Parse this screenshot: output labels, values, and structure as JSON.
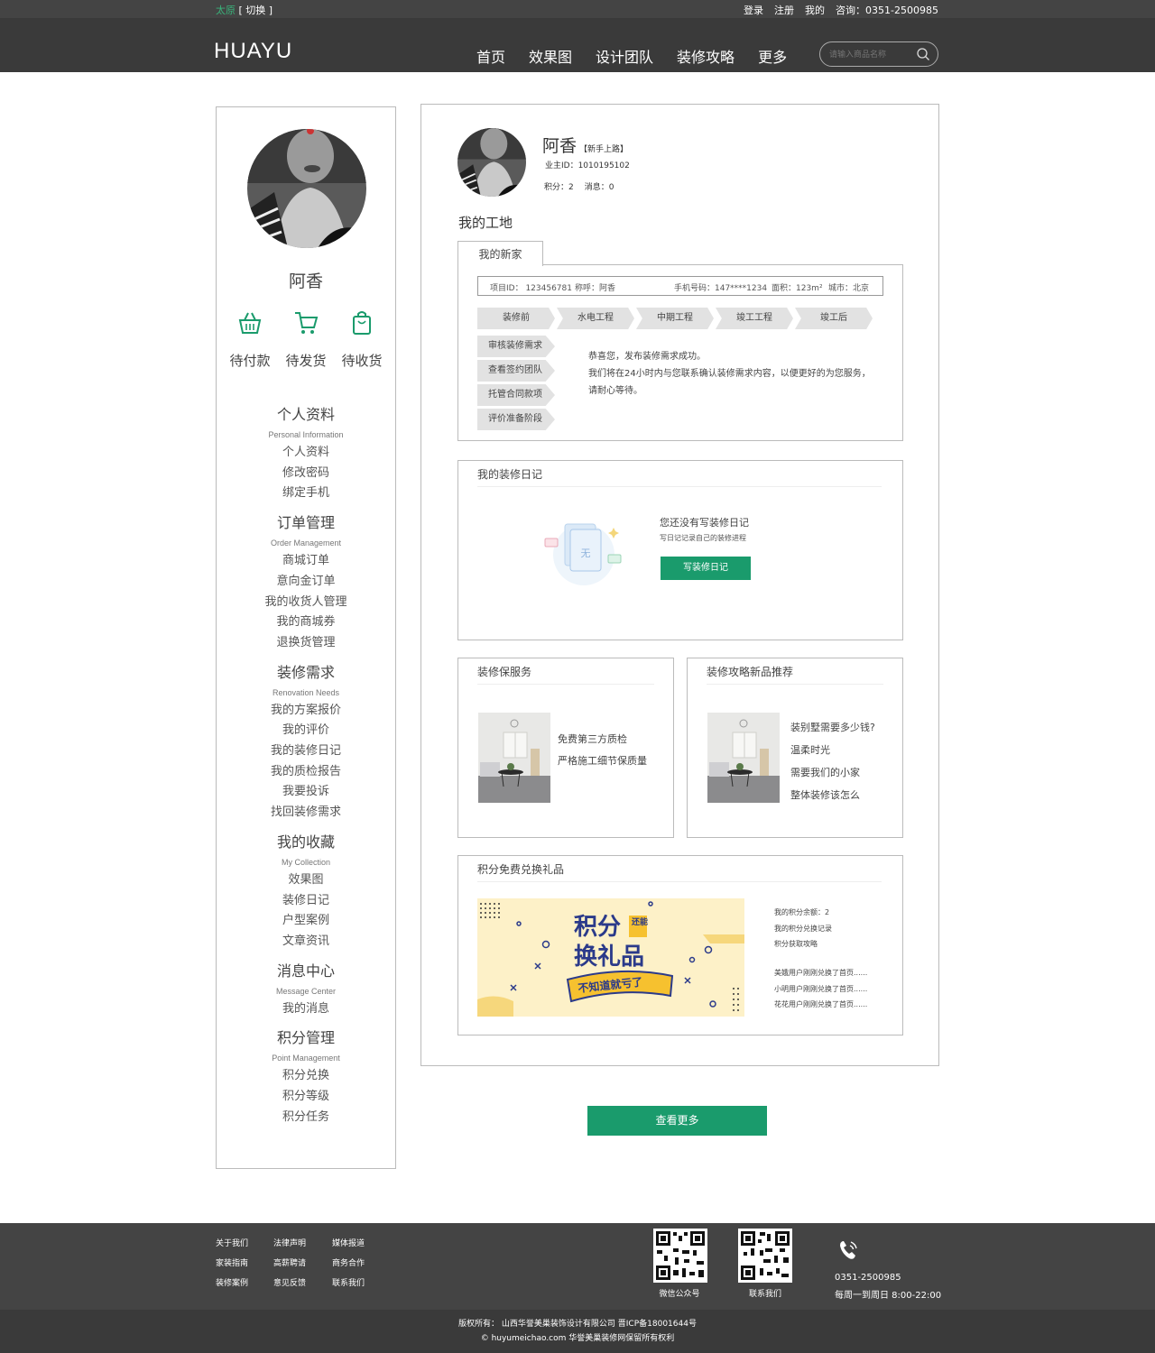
{
  "topbar": {
    "city": "太原",
    "switch": "[ 切换 ]",
    "links": [
      "登录",
      "注册",
      "我的"
    ],
    "consult": "咨询：0351-2500985"
  },
  "header": {
    "logo": "HUAYU",
    "nav": [
      "首页",
      "效果图",
      "设计团队",
      "装修攻略",
      "更多"
    ],
    "search_placeholder": "请输入商品名称"
  },
  "sidebar": {
    "name": "阿香",
    "orders": [
      {
        "label": "待付款",
        "icon": "basket-icon"
      },
      {
        "label": "待发货",
        "icon": "cart-icon"
      },
      {
        "label": "待收货",
        "icon": "bag-icon"
      }
    ],
    "sections": [
      {
        "title": "个人资料",
        "subtitle": "Personal Information",
        "items": [
          "个人资料",
          "修改密码",
          "绑定手机"
        ]
      },
      {
        "title": "订单管理",
        "subtitle": "Order Management",
        "items": [
          "商城订单",
          "意向金订单",
          "我的收货人管理",
          "我的商城券",
          "退换货管理"
        ]
      },
      {
        "title": "装修需求",
        "subtitle": "Renovation Needs",
        "items": [
          "我的方案报价",
          "我的评价",
          "我的装修日记",
          "我的质检报告",
          "我要投诉",
          "找回装修需求"
        ]
      },
      {
        "title": "我的收藏",
        "subtitle": "My Collection",
        "items": [
          "效果图",
          "装修日记",
          "户型案例",
          "文章资讯"
        ]
      },
      {
        "title": "消息中心",
        "subtitle": "Message Center",
        "items": [
          "我的消息"
        ]
      },
      {
        "title": "积分管理",
        "subtitle": "Point Management",
        "items": [
          "积分兑换",
          "积分等级",
          "积分任务"
        ]
      }
    ]
  },
  "profile": {
    "name": "阿香",
    "tag": "【新手上路】",
    "owner_id": "业主ID：1010195102",
    "points": "积分：2",
    "messages": "消息：0"
  },
  "site": {
    "title": "我的工地",
    "tab": "我的新家",
    "project_id": "项目ID：  123456781",
    "nickname": "称呼：阿香",
    "phone": "手机号码：147****1234",
    "area": "面积：123m²",
    "city": "城市：北京",
    "steps": [
      "装修前",
      "水电工程",
      "中期工程",
      "竣工工程",
      "竣工后"
    ],
    "substeps": [
      "审核装修需求",
      "查看签约团队",
      "托管合同款项",
      "评价准备阶段"
    ],
    "message": [
      "恭喜您，发布装修需求成功。",
      "我们将在24小时内与您联系确认装修需求内容，以便更好的为您服务，请耐心等待。"
    ]
  },
  "diary": {
    "title": "我的装修日记",
    "empty_icon_text": "无",
    "empty_title": "您还没有写装修日记",
    "empty_sub": "写日记记录自己的装修进程",
    "button": "写装修日记"
  },
  "service": {
    "title": "装修保服务",
    "lines": [
      "免费第三方质检",
      "严格施工细节保质量"
    ]
  },
  "recommend": {
    "title": "装修攻略新品推荐",
    "lines": [
      "装别墅需要多少钱?",
      "温柔时光",
      "需要我们的小家",
      "整体装修该怎么"
    ]
  },
  "points": {
    "title": "积分免费兑换礼品",
    "banner": {
      "line1": "积分",
      "badge": "还能",
      "line2": "换礼品",
      "ribbon": "不知道就亏了"
    },
    "info": [
      "我的积分余额：2",
      "我的积分兑换记录",
      "积分获取攻略"
    ],
    "feed": [
      "美娥用户刚刚兑换了首页......",
      "小明用户刚刚兑换了首页......",
      "花花用户刚刚兑换了首页......"
    ]
  },
  "more_button": "查看更多",
  "footer": {
    "links": [
      "关于我们",
      "法律声明",
      "媒体报道",
      "家装指南",
      "高薪聘请",
      "商务合作",
      "装修案例",
      "意见反馈",
      "联系我们"
    ],
    "qr1": "微信公众号",
    "qr2": "联系我们",
    "phone": "0351-2500985",
    "hours": "每周一到周日 8:00-22:00",
    "copyright": "版权所有：  山西华誉美巢装饰设计有限公司  晋ICP备18001644号",
    "site": "© huyumeichao.com 华誉美巢装修网保留所有权利"
  },
  "colors": {
    "accent": "#1a9b6c",
    "city": "#39b37a",
    "header": "#3a3a3a"
  }
}
